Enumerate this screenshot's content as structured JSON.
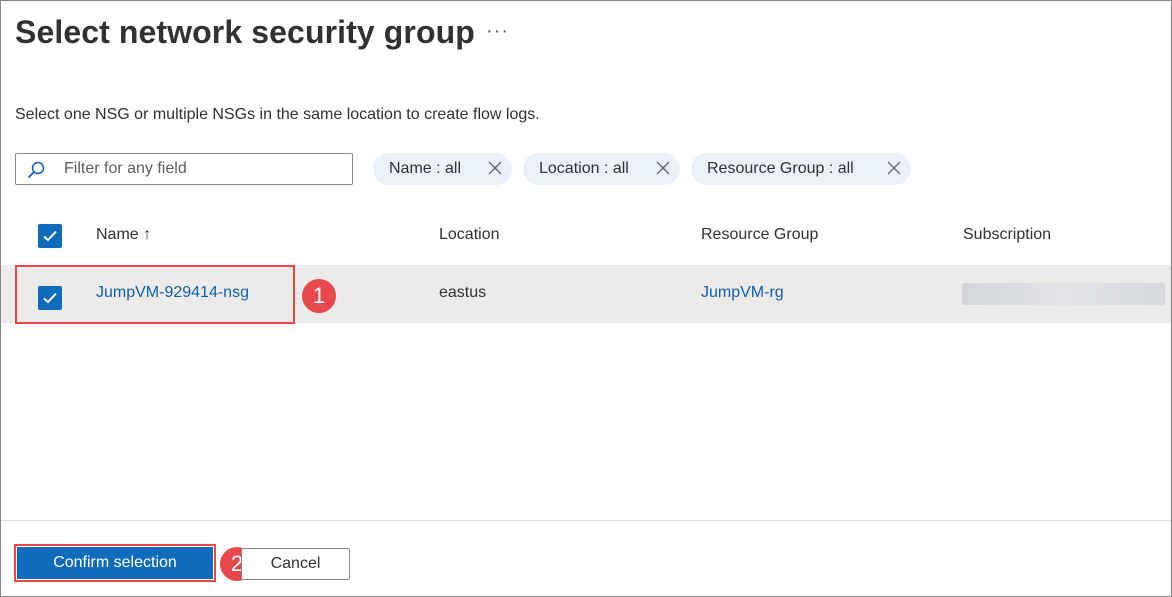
{
  "dialog": {
    "title": "Select network security group",
    "more_label": "···",
    "description": "Select one NSG or multiple NSGs in the same location to create flow logs."
  },
  "filter": {
    "placeholder": "Filter for any field",
    "value": ""
  },
  "pills": [
    {
      "label": "Name : all"
    },
    {
      "label": "Location : all"
    },
    {
      "label": "Resource Group : all"
    }
  ],
  "table": {
    "columns": [
      "Name ↑",
      "Location",
      "Resource Group",
      "Subscription"
    ],
    "rows": [
      {
        "name": "JumpVM-929414-nsg",
        "location": "eastus",
        "resource_group": "JumpVM-rg",
        "subscription": "",
        "selected": true
      }
    ]
  },
  "annotations": {
    "step1": "1",
    "step2": "2"
  },
  "actions": {
    "confirm_label": "Confirm selection",
    "cancel_label": "Cancel"
  },
  "colors": {
    "accent": "#0f6cbd",
    "link": "#0f5fad",
    "highlight": "#e8474b",
    "pill_bg": "#eaf1fb",
    "row_selected_bg": "#edebe9"
  }
}
